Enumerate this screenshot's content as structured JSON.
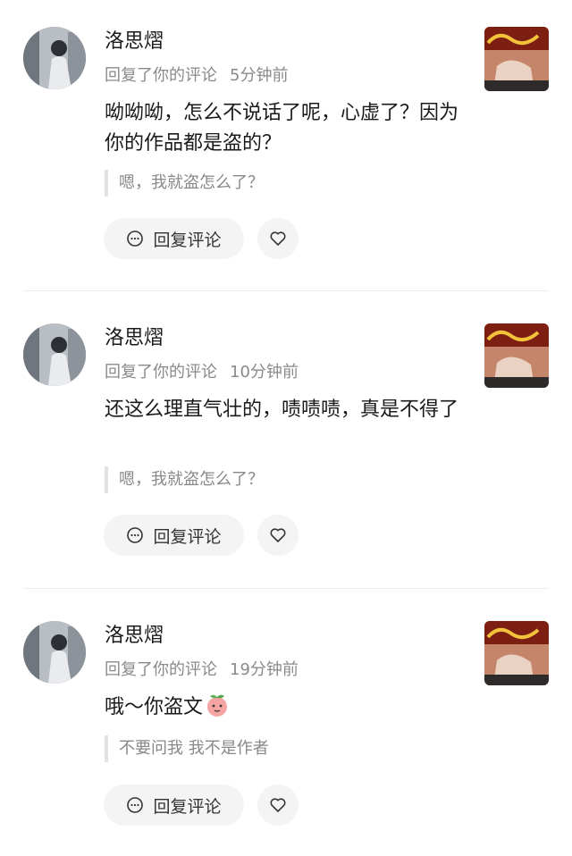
{
  "notifications": [
    {
      "name": "洛思熠",
      "action": "回复了你的评论",
      "time": "5分钟前",
      "content": "呦呦呦，怎么不说话了呢，心虚了？因为你的作品都是盗的？",
      "quote": "嗯，我就盗怎么了？",
      "reply_label": "回复评论"
    },
    {
      "name": "洛思熠",
      "action": "回复了你的评论",
      "time": "10分钟前",
      "content": "还这么理直气壮的，啧啧啧，真是不得了",
      "quote": "嗯，我就盗怎么了？",
      "reply_label": "回复评论"
    },
    {
      "name": "洛思熠",
      "action": "回复了你的评论",
      "time": "19分钟前",
      "content": "哦～你盗文",
      "quote": "不要问我 我不是作者",
      "reply_label": "回复评论"
    }
  ],
  "icons": {
    "reply": "comment-bubble-icon",
    "like": "heart-outline-icon",
    "emoji": "peach-emoji-icon"
  },
  "colors": {
    "text": "#1a1a1a",
    "meta": "#8a8a8a",
    "quote_bar": "#e2e2e2",
    "button_bg": "#f4f4f4"
  }
}
